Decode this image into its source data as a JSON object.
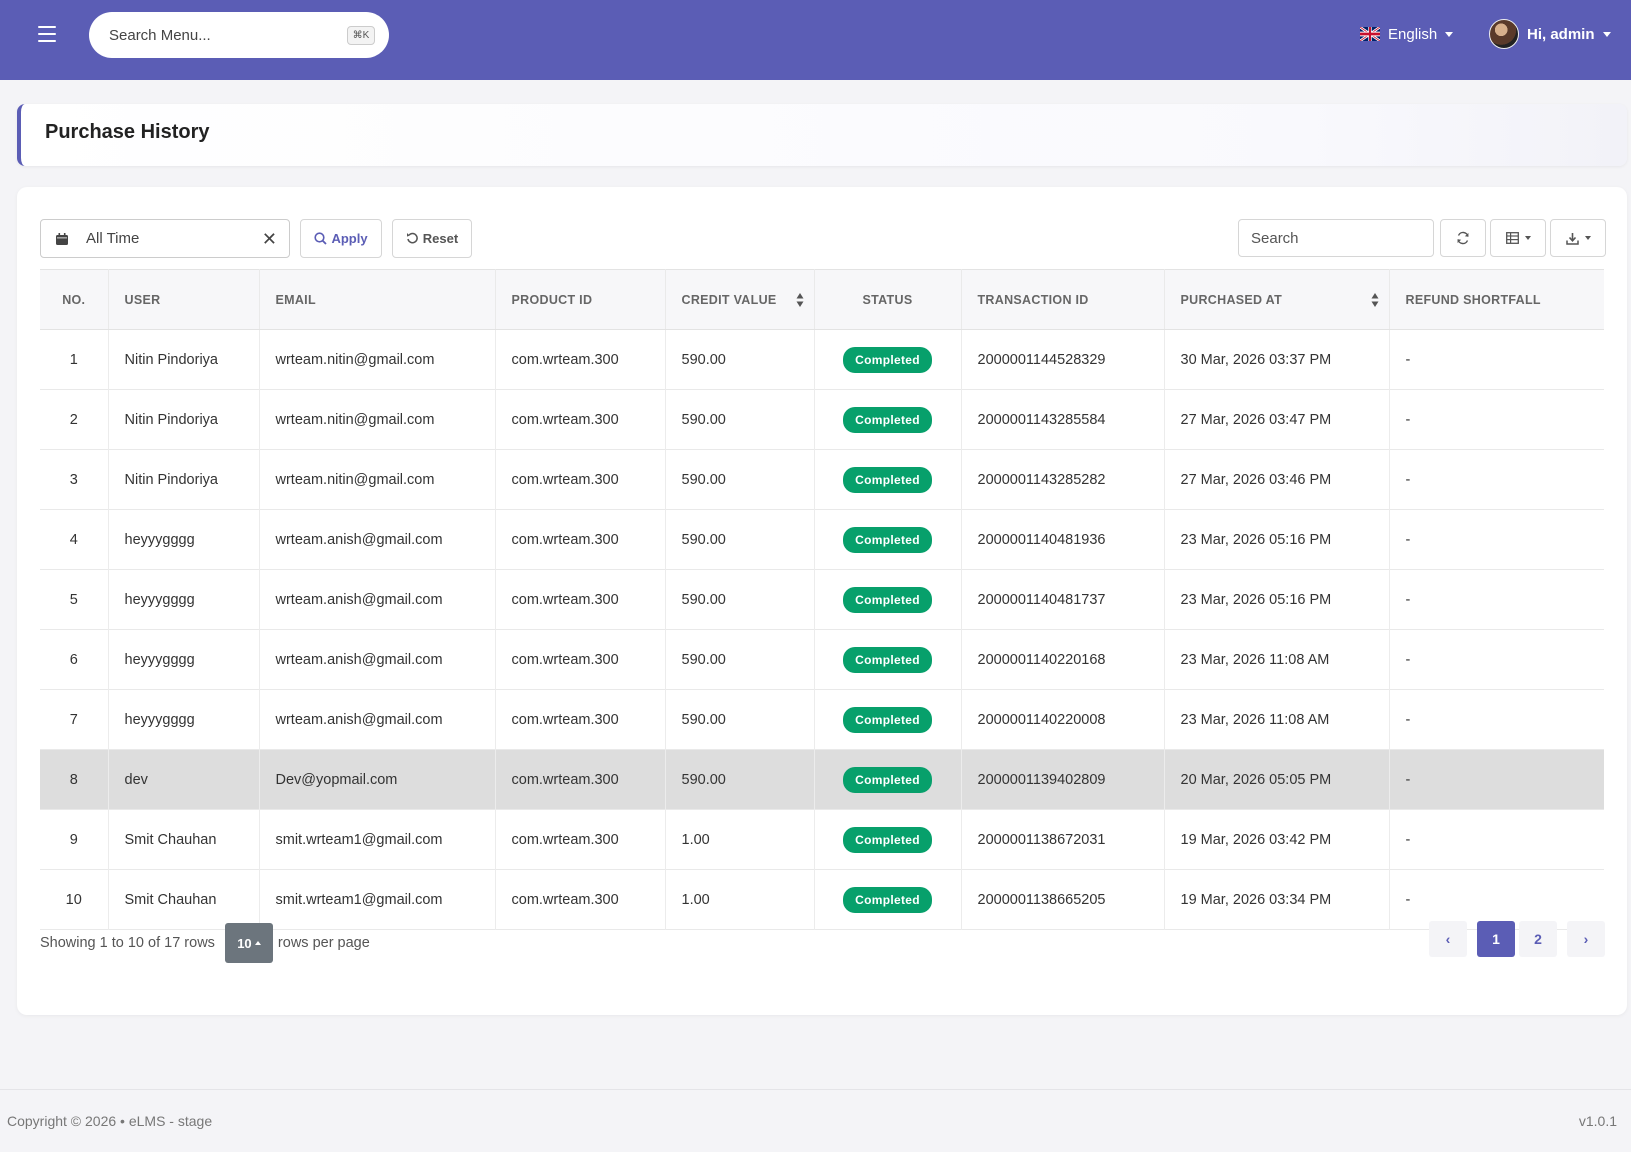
{
  "navbar": {
    "search_placeholder": "Search Menu...",
    "shortcut": "⌘K",
    "language": "English",
    "user_greeting": "Hi, admin"
  },
  "page": {
    "title": "Purchase History"
  },
  "filters": {
    "date_range": "All Time",
    "apply_label": "Apply",
    "reset_label": "Reset",
    "search_placeholder": "Search"
  },
  "table": {
    "columns": [
      "NO.",
      "USER",
      "EMAIL",
      "PRODUCT ID",
      "CREDIT VALUE",
      "STATUS",
      "TRANSACTION ID",
      "PURCHASED AT",
      "REFUND SHORTFALL"
    ],
    "rows": [
      {
        "no": "1",
        "user": "Nitin Pindoriya",
        "email": "wrteam.nitin@gmail.com",
        "product": "com.wrteam.300",
        "credit": "590.00",
        "status": "Completed",
        "txn": "2000001144528329",
        "date": "30 Mar, 2026 03:37 PM",
        "refund": "-"
      },
      {
        "no": "2",
        "user": "Nitin Pindoriya",
        "email": "wrteam.nitin@gmail.com",
        "product": "com.wrteam.300",
        "credit": "590.00",
        "status": "Completed",
        "txn": "2000001143285584",
        "date": "27 Mar, 2026 03:47 PM",
        "refund": "-"
      },
      {
        "no": "3",
        "user": "Nitin Pindoriya",
        "email": "wrteam.nitin@gmail.com",
        "product": "com.wrteam.300",
        "credit": "590.00",
        "status": "Completed",
        "txn": "2000001143285282",
        "date": "27 Mar, 2026 03:46 PM",
        "refund": "-"
      },
      {
        "no": "4",
        "user": "heyyygggg",
        "email": "wrteam.anish@gmail.com",
        "product": "com.wrteam.300",
        "credit": "590.00",
        "status": "Completed",
        "txn": "2000001140481936",
        "date": "23 Mar, 2026 05:16 PM",
        "refund": "-"
      },
      {
        "no": "5",
        "user": "heyyygggg",
        "email": "wrteam.anish@gmail.com",
        "product": "com.wrteam.300",
        "credit": "590.00",
        "status": "Completed",
        "txn": "2000001140481737",
        "date": "23 Mar, 2026 05:16 PM",
        "refund": "-"
      },
      {
        "no": "6",
        "user": "heyyygggg",
        "email": "wrteam.anish@gmail.com",
        "product": "com.wrteam.300",
        "credit": "590.00",
        "status": "Completed",
        "txn": "2000001140220168",
        "date": "23 Mar, 2026 11:08 AM",
        "refund": "-"
      },
      {
        "no": "7",
        "user": "heyyygggg",
        "email": "wrteam.anish@gmail.com",
        "product": "com.wrteam.300",
        "credit": "590.00",
        "status": "Completed",
        "txn": "2000001140220008",
        "date": "23 Mar, 2026 11:08 AM",
        "refund": "-"
      },
      {
        "no": "8",
        "user": "dev",
        "email": "Dev@yopmail.com",
        "product": "com.wrteam.300",
        "credit": "590.00",
        "status": "Completed",
        "txn": "2000001139402809",
        "date": "20 Mar, 2026 05:05 PM",
        "refund": "-"
      },
      {
        "no": "9",
        "user": "Smit Chauhan",
        "email": "smit.wrteam1@gmail.com",
        "product": "com.wrteam.300",
        "credit": "1.00",
        "status": "Completed",
        "txn": "2000001138672031",
        "date": "19 Mar, 2026 03:42 PM",
        "refund": "-"
      },
      {
        "no": "10",
        "user": "Smit Chauhan",
        "email": "smit.wrteam1@gmail.com",
        "product": "com.wrteam.300",
        "credit": "1.00",
        "status": "Completed",
        "txn": "2000001138665205",
        "date": "19 Mar, 2026 03:34 PM",
        "refund": "-"
      }
    ],
    "highlighted_row": "8"
  },
  "pagination": {
    "showing_text": "Showing 1 to 10 of 17 rows",
    "page_size": "10",
    "rows_per_page_text": "rows per page",
    "prev": "‹",
    "pages": [
      "1",
      "2"
    ],
    "current_page": "1",
    "next": "›"
  },
  "footer": {
    "copyright": "Copyright © 2026  •  eLMS - stage",
    "version": "v1.0.1"
  },
  "colors": {
    "primary": "#5b5db5",
    "status_completed": "#07a06b",
    "highlight_row": "#dddddd"
  },
  "icons": [
    "hamburger-icon",
    "uk-flag-icon",
    "calendar-icon",
    "close-icon",
    "search-icon",
    "reset-icon",
    "refresh-icon",
    "columns-icon",
    "download-icon",
    "sort-icon"
  ]
}
